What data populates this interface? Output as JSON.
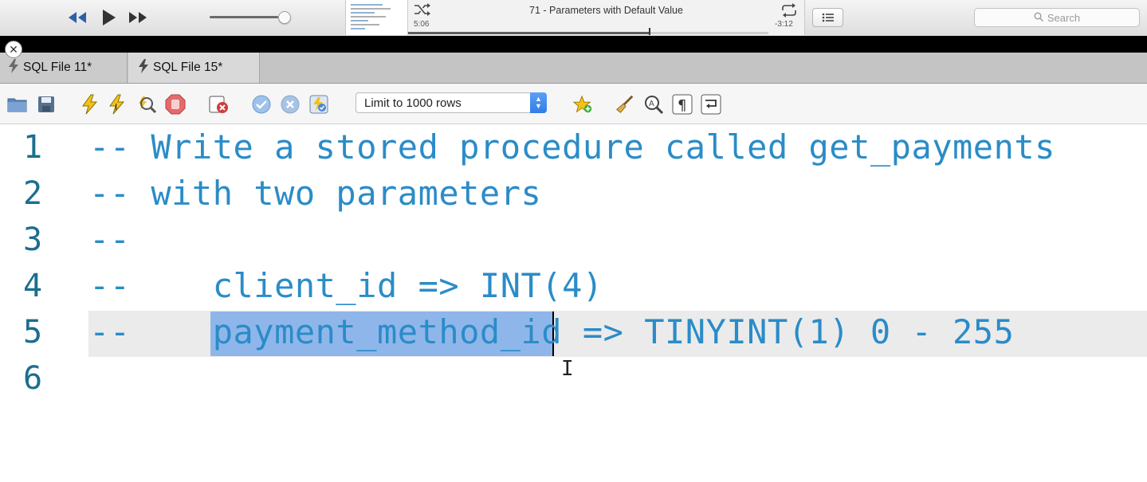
{
  "media_player": {
    "now_playing": "71 - Parameters with Default Value",
    "elapsed": "5:06",
    "remaining": "-3:12",
    "progress_fraction": 0.67,
    "volume_fraction": 0.9,
    "search_placeholder": "Search",
    "icons": [
      "rewind-icon",
      "play-icon",
      "fast-forward-icon",
      "shuffle-icon",
      "repeat-icon",
      "list-icon",
      "search-icon"
    ]
  },
  "tabs": [
    {
      "label": "SQL File 11*",
      "active": false
    },
    {
      "label": "SQL File 15*",
      "active": true
    }
  ],
  "toolbar": {
    "limit_select": {
      "selected": "Limit to 1000 rows"
    },
    "icons": [
      "open-folder-icon",
      "save-icon",
      "execute-icon",
      "execute-current-icon",
      "explain-icon",
      "stop-icon",
      "toggle-error-stop-icon",
      "commit-icon",
      "rollback-icon",
      "autocommit-icon",
      "add-snippet-icon",
      "beautify-icon",
      "find-icon",
      "invisibles-icon",
      "wrap-lines-icon"
    ]
  },
  "editor": {
    "lines": [
      {
        "num": "1",
        "text": "-- Write a stored procedure called get_payments"
      },
      {
        "num": "2",
        "text": "-- with two parameters"
      },
      {
        "num": "3",
        "text": "--"
      },
      {
        "num": "4",
        "text": "--    client_id => INT(4)"
      },
      {
        "num": "5",
        "text": "--    payment_method_id => TINYINT(1) 0 - 255"
      },
      {
        "num": "6",
        "text": ""
      }
    ],
    "selected_text": "payment_method_id",
    "current_line": 5
  },
  "colors": {
    "comment": "#2a8cc8",
    "line_number": "#1b6e8e",
    "selection": "#8fb6ea",
    "current_line_bg": "#ebebeb"
  }
}
